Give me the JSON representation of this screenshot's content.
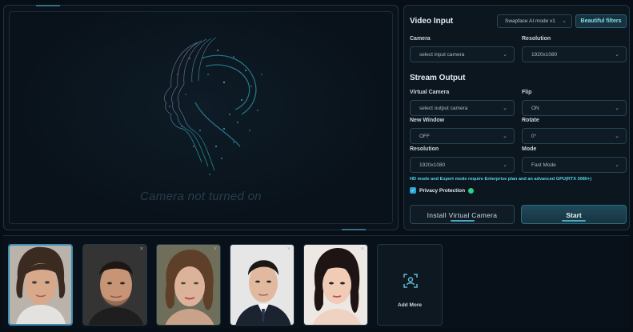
{
  "preview": {
    "status_text": "Camera not turned on"
  },
  "settings": {
    "video_input": {
      "title": "Video Input",
      "model_select": "Swapface AI mode v1",
      "beautiful_filters": "Beautiful filters",
      "camera_label": "Camera",
      "camera_value": "select input camera",
      "resolution_label": "Resolution",
      "resolution_value": "1920x1080"
    },
    "stream_output": {
      "title": "Stream Output",
      "virtual_camera_label": "Virtual Camera",
      "virtual_camera_value": "select output camera",
      "flip_label": "Flip",
      "flip_value": "ON",
      "new_window_label": "New Window",
      "new_window_value": "OFF",
      "rotate_label": "Rotate",
      "rotate_value": "0°",
      "resolution_label": "Resolution",
      "resolution_value": "1920x1080",
      "mode_label": "Mode",
      "mode_value": "Fast Mode"
    },
    "note": "HD mode and Expert mode require Enterprise plan and an advanced GPU(RTX 3080+)",
    "privacy_label": "Privacy Protection",
    "privacy_checked": true,
    "install_button": "Install Virtual Camera",
    "start_button": "Start"
  },
  "faces": {
    "add_more_label": "Add More",
    "close_glyph": "×",
    "cards": [
      {
        "name": "face-1",
        "active": true
      },
      {
        "name": "face-2",
        "active": false
      },
      {
        "name": "face-3",
        "active": false
      },
      {
        "name": "face-4",
        "active": false
      },
      {
        "name": "face-5",
        "active": false
      }
    ]
  },
  "colors": {
    "accent": "#56d5e6",
    "start_button": "#1f4a5b",
    "background": "#070e15"
  },
  "icons": {
    "chevron": "chevron-down-icon",
    "add_face": "face-scan-icon",
    "check": "check-icon",
    "info": "info-dot-icon"
  }
}
